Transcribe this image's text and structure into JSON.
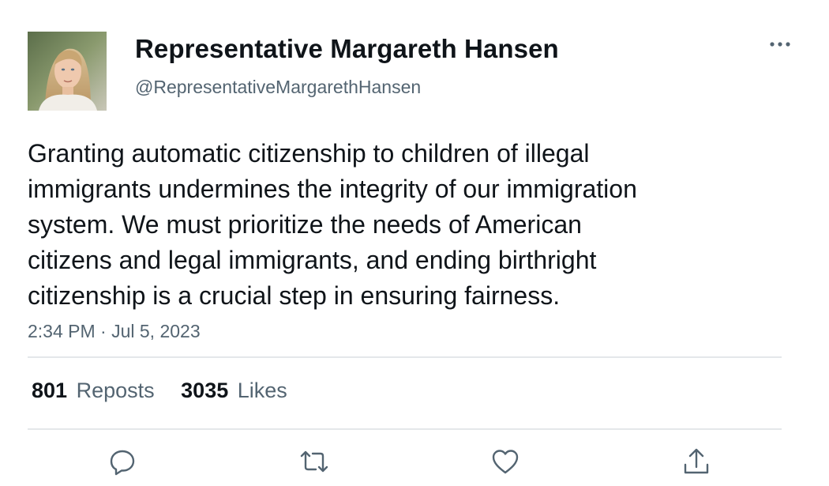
{
  "author": {
    "display_name": "Representative Margareth Hansen",
    "handle": "@RepresentativeMargarethHansen"
  },
  "tweet": {
    "text_lines": [
      "Granting automatic citizenship to children of illegal",
      "immigrants undermines the integrity of our immigration",
      "system. We must prioritize the needs of American",
      "citizens and legal immigrants, and ending birthright",
      "citizenship is a crucial step in ensuring fairness."
    ],
    "timestamp": "2:34 PM · Jul 5, 2023"
  },
  "stats": {
    "reposts_count": "801",
    "reposts_label": "Reposts",
    "likes_count": "3035",
    "likes_label": "Likes"
  },
  "icons": {
    "more": "more-horizontal-icon",
    "reply": "reply-icon",
    "repost": "repost-icon",
    "like": "heart-icon",
    "share": "share-icon"
  },
  "colors": {
    "text_primary": "#0f1419",
    "text_secondary": "#536471",
    "divider": "#e4e7ea",
    "icon": "#536471"
  }
}
